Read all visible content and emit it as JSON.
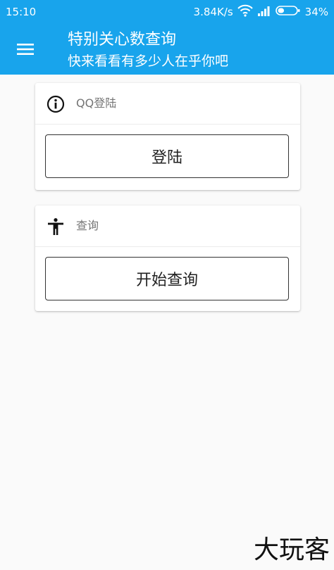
{
  "status_bar": {
    "time": "15:10",
    "network_speed": "3.84K/s",
    "battery": "34%",
    "battery_level": 0.34,
    "icons": [
      "wifi-icon",
      "signal-icon",
      "battery-icon"
    ]
  },
  "toolbar": {
    "title": "特别关心数查询",
    "subtitle": "快来看看有多少人在乎你吧",
    "menu_icon": "hamburger-menu-icon"
  },
  "login_card": {
    "header_icon": "info-icon",
    "header_label": "QQ登陆",
    "button_label": "登陆"
  },
  "query_card": {
    "header_icon": "accessibility-person-icon",
    "header_label": "查询",
    "button_label": "开始查询"
  },
  "watermark": "大玩客",
  "colors": {
    "primary": "#18a4ec",
    "background": "#fafafa",
    "card": "#ffffff",
    "header_text": "#757575",
    "button_border": "#333333"
  }
}
